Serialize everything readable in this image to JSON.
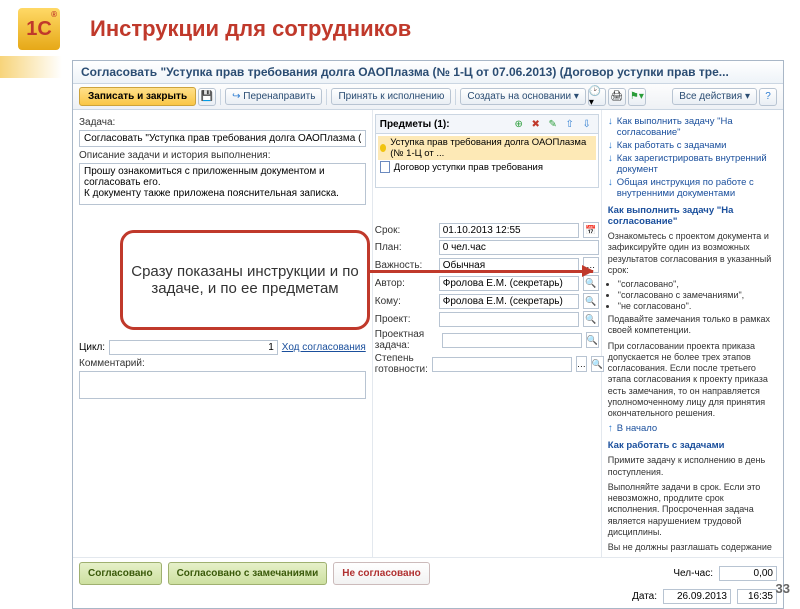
{
  "slide": {
    "title": "Инструкции для сотрудников",
    "logo": "1С",
    "page": "33"
  },
  "window": {
    "title": "Согласовать \"Уступка прав требования долга ОАОПлазма (№ 1-Ц от 07.06.2013) (Договор уступки прав тре...",
    "toolbar": {
      "save": "Записать и закрыть",
      "redirect": "Перенаправить",
      "accept": "Принять к исполнению",
      "create": "Создать на основании",
      "all_actions": "Все действия"
    }
  },
  "left": {
    "task_label": "Задача:",
    "task_value": "Согласовать \"Уступка прав требования долга ОАОПлазма (№ 1-Ц от 07.06.2013) (",
    "desc_label": "Описание задачи и история выполнения:",
    "desc_value": "Прошу ознакомиться с приложенным документом и согласовать его.\nК документу также приложена пояснительная записка.",
    "cycle_label": "Цикл:",
    "cycle_value": "1",
    "cycle_link": "Ход согласования",
    "comment_label": "Комментарий:"
  },
  "mid": {
    "subjects_label": "Предметы (1):",
    "items": [
      {
        "text": "Уступка прав требования долга ОАОПлазма (№ 1-Ц от ..."
      },
      {
        "text": "Договор уступки прав требования"
      }
    ],
    "fields": {
      "srok_l": "Срок:",
      "srok_v": "01.10.2013 12:55",
      "plan_l": "План:",
      "plan_v": "0 чел.час",
      "vazh_l": "Важность:",
      "vazh_v": "Обычная",
      "author_l": "Автор:",
      "author_v": "Фролова Е.М. (секретарь)",
      "komu_l": "Кому:",
      "komu_v": "Фролова Е.М. (секретарь)",
      "proj_l": "Проект:",
      "projz_l": "Проектная задача:",
      "ready_l": "Степень готовности:"
    }
  },
  "right": {
    "links": [
      "Как выполнить задачу \"На согласование\"",
      "Как работать с задачами",
      "Как зарегистрировать внутренний документ",
      "Общая инструкция по работе с внутренними документами"
    ],
    "h1": "Как выполнить задачу \"На согласование\"",
    "p1": "Ознакомьтесь с проектом документа и зафиксируйте один из возможных результатов согласования в указанный срок:",
    "b1": "\"согласовано\",",
    "b2": "\"согласовано с замечаниями\",",
    "b3": "\"не согласовано\".",
    "p2": "Подавайте замечания только в рамках своей компетенции.",
    "p3": "При согласовании проекта приказа допускается не более трех этапов согласования. Если после третьего этапа согласования к проекту приказа есть замечания, то он направляется уполномоченному лицу для принятия окончательного решения.",
    "begin": "В начало",
    "h2": "Как работать с задачами",
    "p4": "Примите задачу к исполнению в день поступления.",
    "p5": "Выполняйте задачи в срок. Если это невозможно, продлите срок исполнения. Просроченная задача является нарушением трудовой дисциплины.",
    "p6": "Вы не должны разглашать содержание"
  },
  "footer": {
    "s1": "Согласовано",
    "s2": "Согласовано с замечаниями",
    "s3": "Не согласовано",
    "hh_l": "Чел-час:",
    "hh_v": "0,00",
    "date_l": "Дата:",
    "date_v": "26.09.2013",
    "time_v": "16:35"
  },
  "callout": "Сразу показаны инструкции и по задаче, и по ее предметам"
}
